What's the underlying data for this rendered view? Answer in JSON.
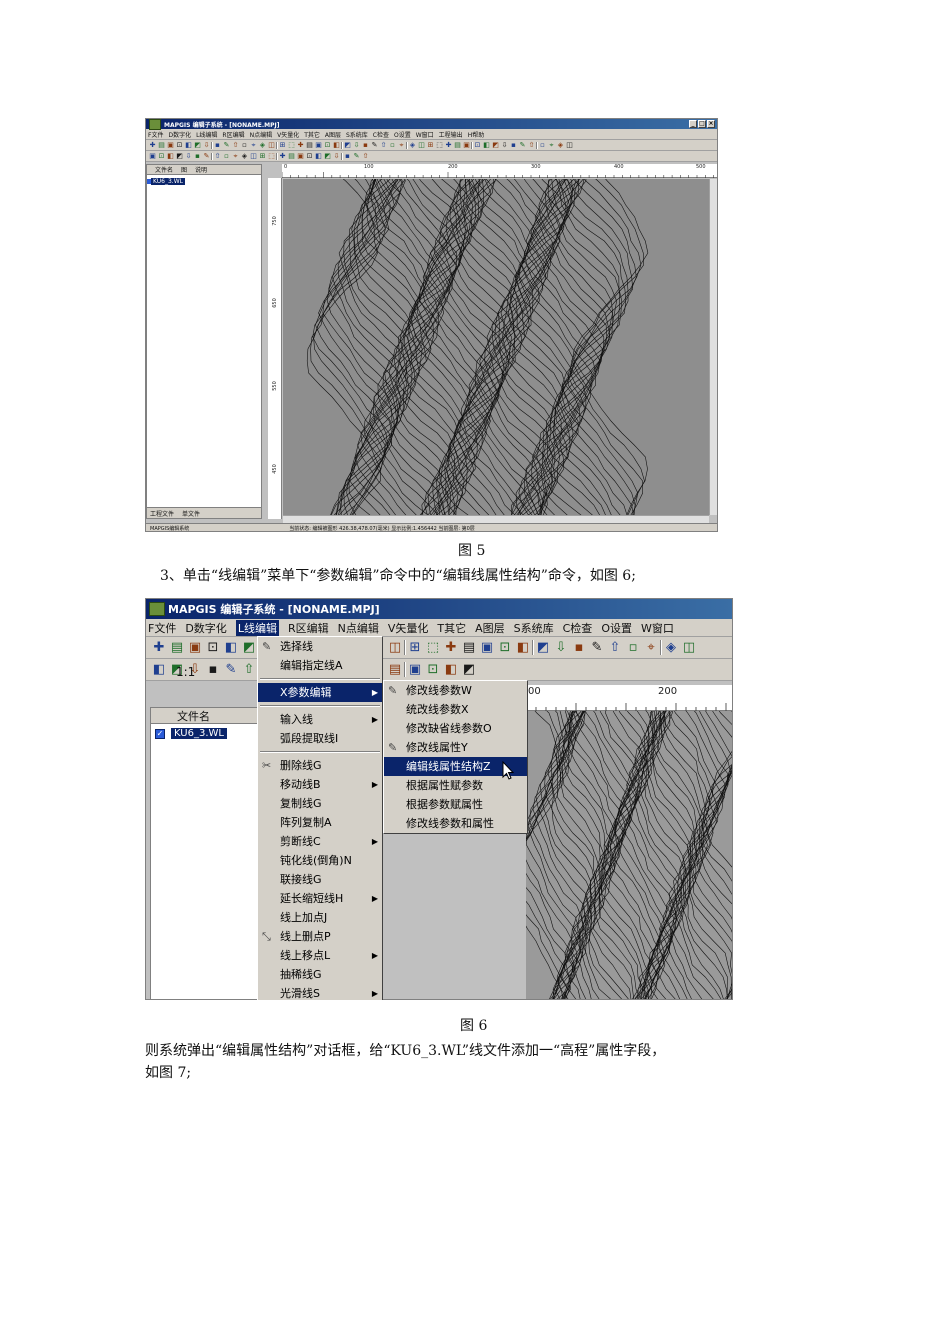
{
  "figure5": {
    "window_title": "MAPGIS 编辑子系统 - [NONAME.MPJ]",
    "menu": [
      "F文件",
      "D数字化",
      "L线编辑",
      "R区编辑",
      "N点编辑",
      "V矢量化",
      "T其它",
      "A图层",
      "S系统库",
      "C检查",
      "O设置",
      "W窗口",
      "工程输出",
      "H帮助"
    ],
    "sidebar_headers": [
      "文件名",
      "图",
      "说明"
    ],
    "file_name": "KU6_3.WL",
    "sidebar_tabs": [
      "工程文件",
      "单文件"
    ],
    "ruler_top": [
      "0",
      "100",
      "200",
      "300",
      "400",
      "500"
    ],
    "ruler_left": [
      "750",
      "650",
      "550",
      "450"
    ],
    "status_left": "MAPGIS编辑系统",
    "status_right": "当前状态: 编辑被图形  426.38,478.07(毫米)  显示比例:1.456442  当前图层: 第0层"
  },
  "caption5": "图 5",
  "step3_text": "3、单击“线编辑”菜单下“参数编辑”命令中的“编辑线属性结构”命令，如图 6;",
  "figure6": {
    "window_title": "MAPGIS 编辑子系统 - [NONAME.MPJ]",
    "menu": [
      "F文件",
      "D数字化",
      "L线编辑",
      "R区编辑",
      "N点编辑",
      "V矢量化",
      "T其它",
      "A图层",
      "S系统库",
      "C检查",
      "O设置",
      "W窗口"
    ],
    "sidebar_header": "文件名",
    "file_name": "KU6_3.WL",
    "zoom_label": "1:1",
    "ruler_top": [
      "00",
      "200"
    ],
    "line_menu": [
      {
        "label": "选择线",
        "icon": "select-line-icon"
      },
      {
        "label": "编辑指定线A"
      },
      {
        "sep": true
      },
      {
        "label": "X参数编辑",
        "submenu": true,
        "highlight": true
      },
      {
        "sep": true
      },
      {
        "label": "输入线",
        "submenu": true
      },
      {
        "label": "弧段提取线I"
      },
      {
        "sep": true
      },
      {
        "label": "删除线G",
        "icon": "scissors-icon"
      },
      {
        "label": "移动线B",
        "submenu": true
      },
      {
        "label": "复制线G"
      },
      {
        "label": "阵列复制A"
      },
      {
        "label": "剪断线C",
        "submenu": true
      },
      {
        "label": "钝化线(倒角)N"
      },
      {
        "label": "联接线G"
      },
      {
        "label": "延长缩短线H",
        "submenu": true
      },
      {
        "label": "线上加点J"
      },
      {
        "label": "线上删点P",
        "icon": "delete-point-icon"
      },
      {
        "label": "线上移点L",
        "submenu": true
      },
      {
        "label": "抽稀线G"
      },
      {
        "label": "光滑线S",
        "submenu": true
      }
    ],
    "param_menu": [
      {
        "label": "修改线参数W",
        "icon": "edit-param-icon"
      },
      {
        "label": "统改线参数X"
      },
      {
        "label": "修改缺省线参数O"
      },
      {
        "label": "修改线属性Y",
        "icon": "edit-attr-icon"
      },
      {
        "label": "编辑线属性结构Z",
        "highlight": true
      },
      {
        "label": "根据属性赋参数"
      },
      {
        "label": "根据参数赋属性"
      },
      {
        "label": "修改线参数和属性"
      }
    ]
  },
  "caption6": "图 6",
  "after_line1": "则系统弹出“编辑属性结构”对话框，给“KU6_3.WL”线文件添加一“高程”属性字段，",
  "after_line2": "如图 7;"
}
